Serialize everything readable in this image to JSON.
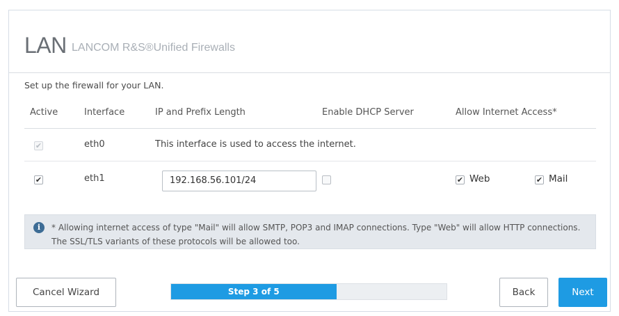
{
  "header": {
    "title": "LAN",
    "subtitle": "LANCOM R&S®Unified Firewalls"
  },
  "intro": "Set up the firewall for your LAN.",
  "table": {
    "columns": [
      "Active",
      "Interface",
      "IP and Prefix Length",
      "Enable DHCP Server",
      "Allow Internet Access*"
    ],
    "rows": [
      {
        "active": true,
        "active_disabled": true,
        "interface": "eth0",
        "note": "This interface is used to access the internet."
      },
      {
        "active": true,
        "interface": "eth1",
        "ip_value": "192.168.56.101/24",
        "dhcp": false,
        "web": true,
        "web_label": "Web",
        "mail": true,
        "mail_label": "Mail"
      }
    ]
  },
  "info": {
    "icon": "info-icon",
    "text": "* Allowing internet access of type \"Mail\" will allow SMTP, POP3 and IMAP connections. Type \"Web\" will allow HTTP connections. The SSL/TLS variants of these protocols will be allowed too."
  },
  "footer": {
    "cancel_label": "Cancel Wizard",
    "progress_text": "Step 3 of 5",
    "progress_fraction": 0.6,
    "back_label": "Back",
    "next_label": "Next"
  },
  "colors": {
    "accent": "#1e9be3",
    "info_bg": "#e4e8ed",
    "info_icon": "#3d6c95"
  }
}
